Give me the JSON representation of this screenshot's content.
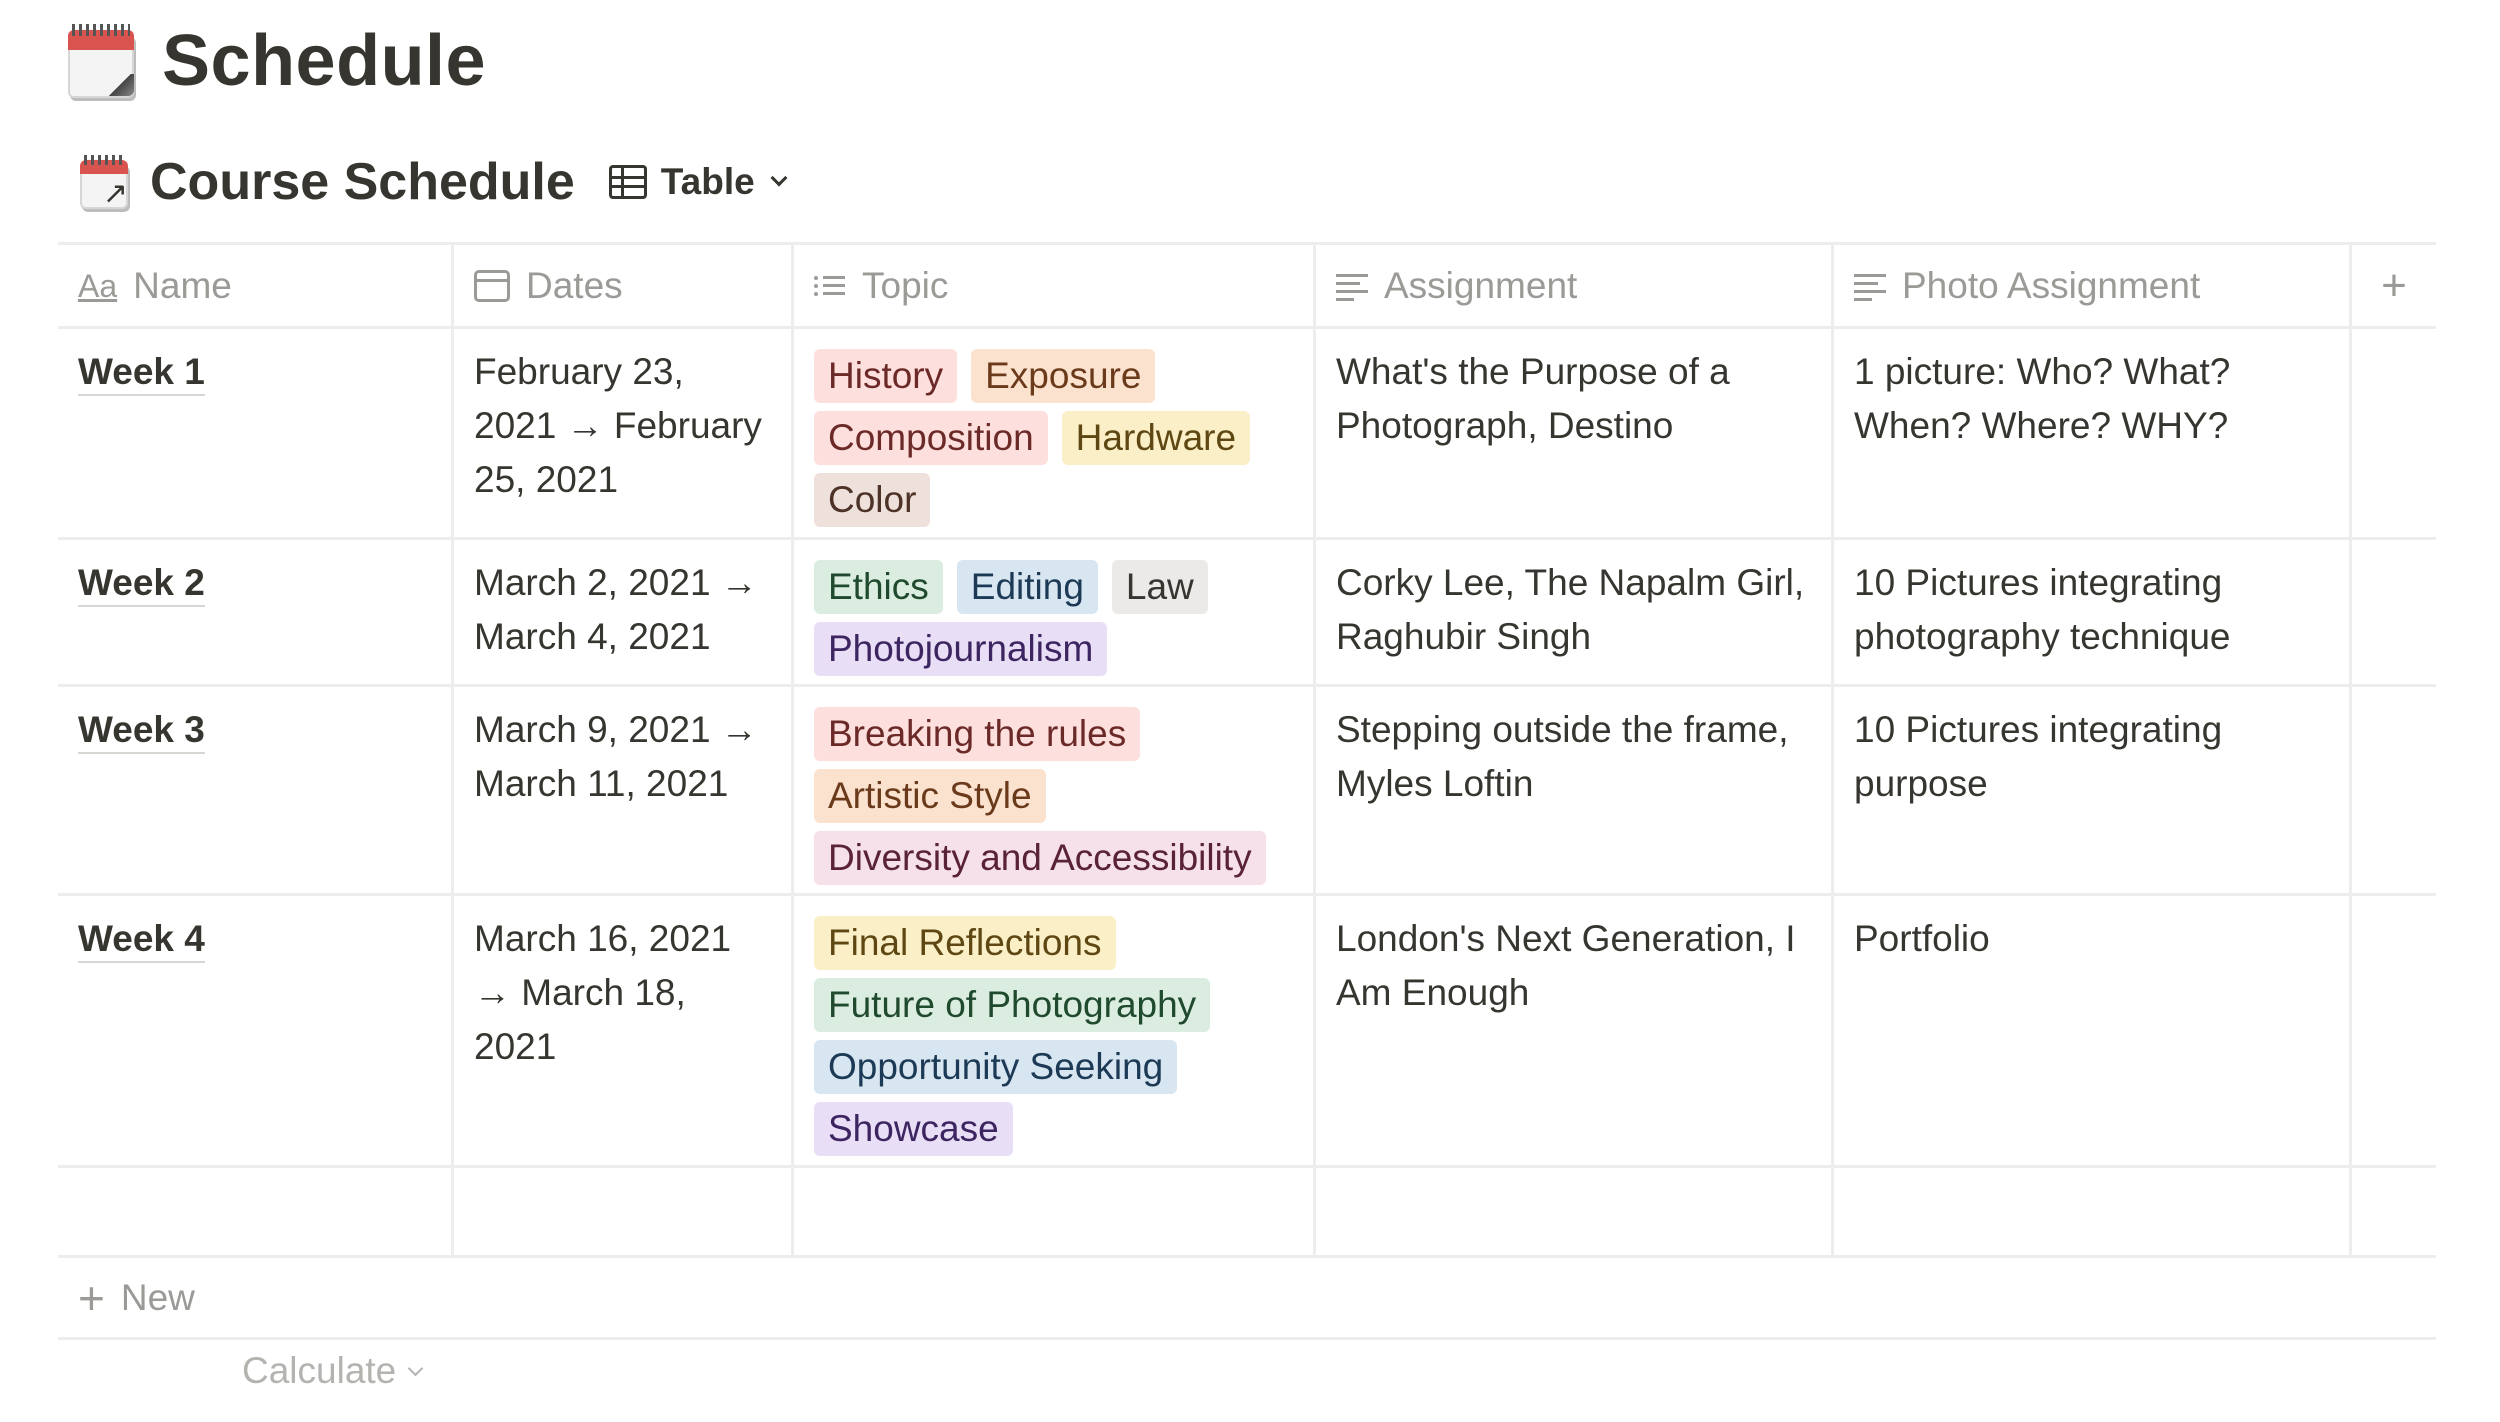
{
  "page": {
    "title": "Schedule",
    "icon": "calendar-icon"
  },
  "database": {
    "title": "Course Schedule",
    "icon": "calendar-link-icon",
    "view_label": "Table",
    "view_icon": "table-icon"
  },
  "columns": [
    {
      "label": "Name",
      "icon": "title-aa-icon"
    },
    {
      "label": "Dates",
      "icon": "date-icon"
    },
    {
      "label": "Topic",
      "icon": "multi-select-icon"
    },
    {
      "label": "Assignment",
      "icon": "text-icon"
    },
    {
      "label": "Photo Assignment",
      "icon": "text-icon"
    }
  ],
  "add_column_label": "+",
  "rows": [
    {
      "name": "Week 1",
      "dates": "February 23, 2021 → February 25, 2021",
      "topics": [
        {
          "label": "History",
          "color": "#fde0dd"
        },
        {
          "label": "Exposure",
          "color": "#fbe2cf"
        },
        {
          "label": "Composition",
          "color": "#fde0dd"
        },
        {
          "label": "Hardware",
          "color": "#fbefc7"
        },
        {
          "label": "Color",
          "color": "#eee0da"
        }
      ],
      "assignment": "What's the Purpose of a Photograph, Destino",
      "photo_assignment": "1 picture: Who? What? When? Where? WHY?"
    },
    {
      "name": "Week 2",
      "dates": "March 2, 2021 → March 4, 2021",
      "topics": [
        {
          "label": "Ethics",
          "color": "#dbede0"
        },
        {
          "label": "Editing",
          "color": "#d8e6f1"
        },
        {
          "label": "Law",
          "color": "#ebeae8"
        },
        {
          "label": "Photojournalism",
          "color": "#e8def6"
        }
      ],
      "assignment": "Corky Lee, The Napalm Girl, Raghubir Singh",
      "photo_assignment": "10 Pictures integrating photography technique"
    },
    {
      "name": "Week 3",
      "dates": "March 9, 2021 → March 11, 2021",
      "topics": [
        {
          "label": "Breaking the rules",
          "color": "#fde0dd"
        },
        {
          "label": "Artistic Style",
          "color": "#fbe2cf"
        },
        {
          "label": "Diversity and Accessibility",
          "color": "#f6e1ea"
        }
      ],
      "assignment": "Stepping outside the frame, Myles Loftin",
      "photo_assignment": "10 Pictures integrating purpose"
    },
    {
      "name": "Week 4",
      "dates": "March 16, 2021 → March 18, 2021",
      "topics": [
        {
          "label": "Final Reflections",
          "color": "#fbefc7"
        },
        {
          "label": "Future of Photography",
          "color": "#dbede0"
        },
        {
          "label": "Opportunity Seeking",
          "color": "#d8e6f1"
        },
        {
          "label": "Showcase",
          "color": "#e8def6"
        }
      ],
      "assignment": "London's Next Generation, I Am Enough",
      "photo_assignment": "Portfolio"
    }
  ],
  "footer": {
    "new_label": "New",
    "calculate_label": "Calculate"
  }
}
